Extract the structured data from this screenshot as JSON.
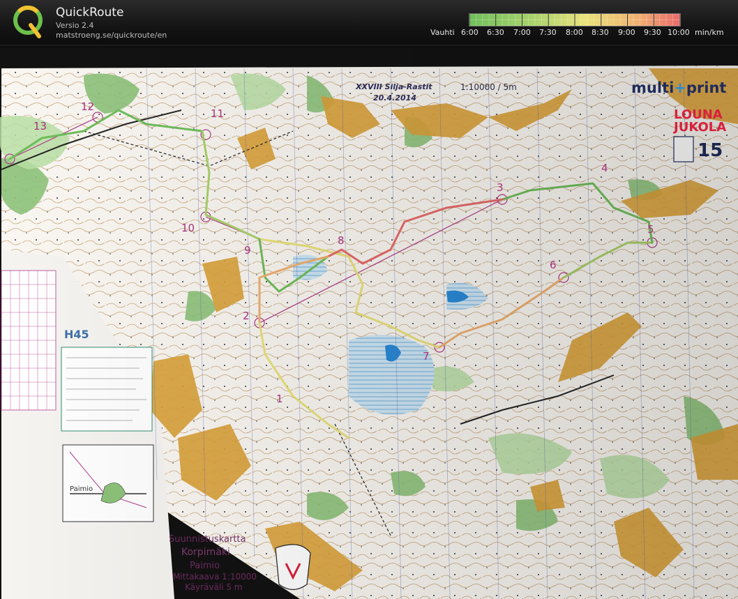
{
  "app": {
    "title": "QuickRoute",
    "version": "Versio 2.4",
    "url": "matstroeng.se/quickroute/en"
  },
  "pace_legend": {
    "label": "Vauhti",
    "ticks": [
      "6:00",
      "6:30",
      "7:00",
      "7:30",
      "8:00",
      "8:30",
      "9:00",
      "9:30",
      "10:00"
    ],
    "unit": "min/km",
    "gradient_colors": [
      "#6fbe5a",
      "#a9d26a",
      "#e9e27a",
      "#f0b070",
      "#e86a6a"
    ]
  },
  "map": {
    "event": "XXVIII Silja-Rastit",
    "date": "20.4.2014",
    "scale": "1:10000 / 5m",
    "sponsor_a": "multi",
    "sponsor_plus": "+",
    "sponsor_b": "print",
    "sponsor2_line1": "LOUNA",
    "sponsor2_line2": "JUKOLA",
    "class_label": "H45",
    "map_name_line1": "Suunnistuskartta",
    "map_name_line2": "Korpimäki",
    "map_name_line3": "Paimio",
    "map_name_line4": "Mittakaava 1:10000",
    "map_name_line5": "Käyräväli 5 m",
    "inset_label": "Paimio",
    "controls": [
      "1",
      "2",
      "3",
      "4",
      "5",
      "6",
      "7",
      "8",
      "9",
      "10",
      "11",
      "12",
      "13"
    ]
  }
}
